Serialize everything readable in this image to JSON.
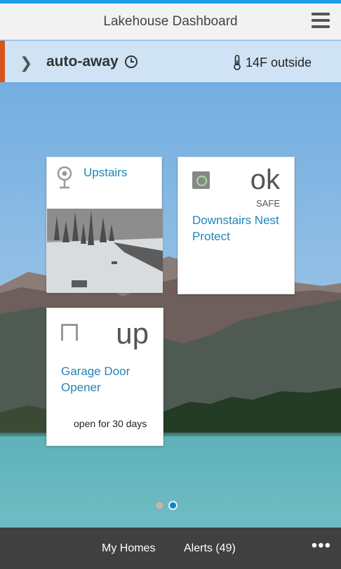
{
  "header": {
    "title": "Lakehouse Dashboard",
    "menu_icon": "hamburger-menu-icon"
  },
  "status_bar": {
    "mode": "auto-away",
    "mode_icon": "clock-icon",
    "temperature": "14F outside",
    "temperature_icon": "thermometer-icon"
  },
  "tiles": {
    "camera": {
      "title": "Upstairs",
      "icon": "camera-icon"
    },
    "protect": {
      "status": "ok",
      "substatus": "SAFE",
      "title": "Downstairs Nest Protect",
      "icon": "nest-protect-icon"
    },
    "garage": {
      "state": "up",
      "title": "Garage Door Opener",
      "status": "open for 30 days",
      "icon": "garage-door-icon"
    }
  },
  "pager": {
    "pages": 2,
    "active": 2
  },
  "footer": {
    "my_homes": "My Homes",
    "alerts": "Alerts (49)",
    "more": "•••"
  },
  "colors": {
    "accent_blue": "#1e9be6",
    "status_orange": "#d9541a",
    "link_blue": "#1f86b8",
    "footer_bg": "#404040"
  }
}
